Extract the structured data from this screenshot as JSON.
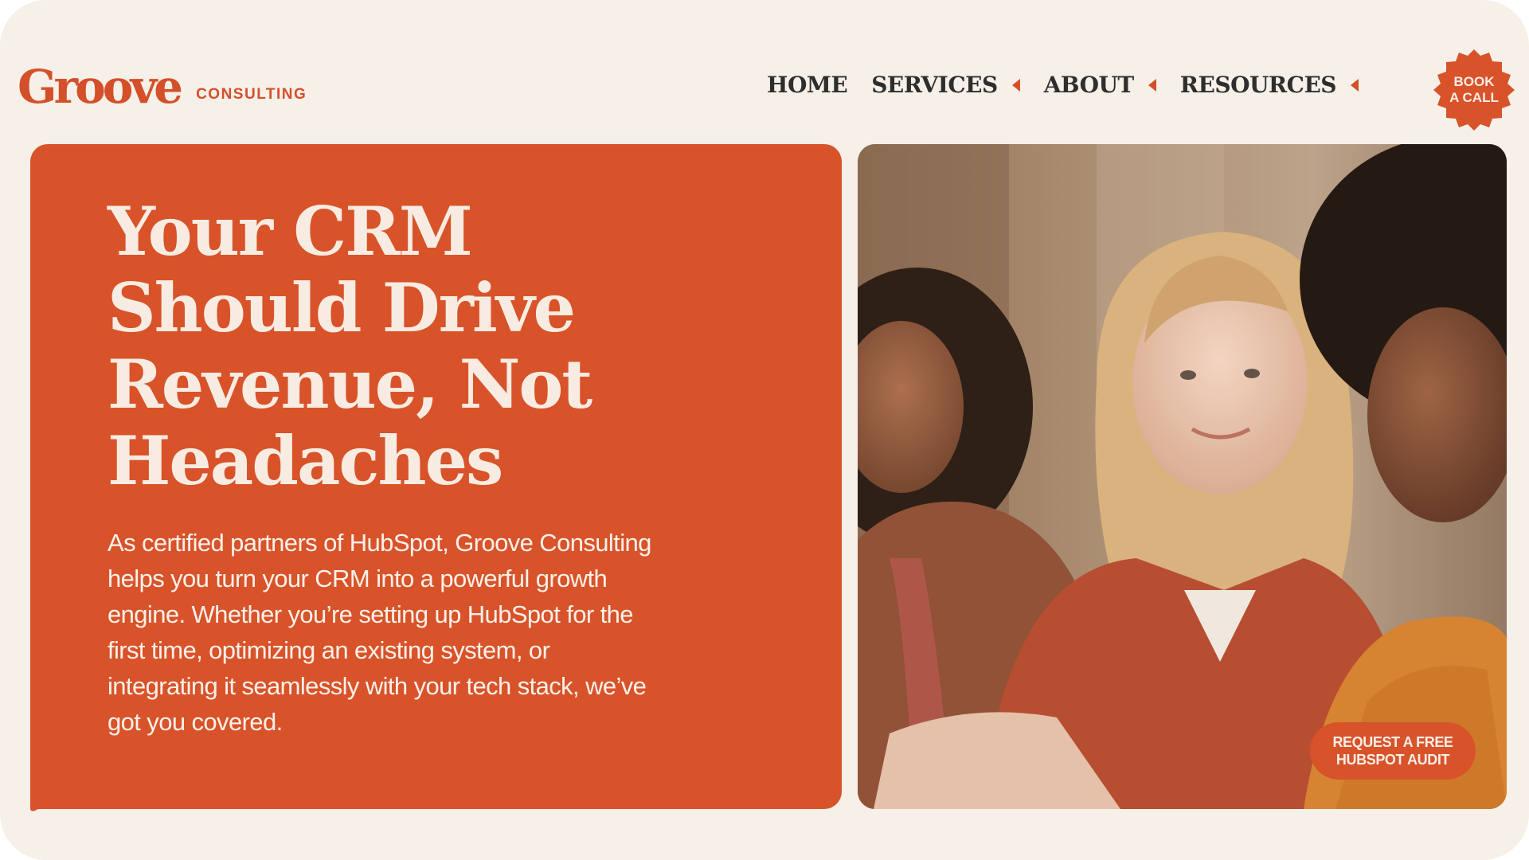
{
  "brand": {
    "logo_word": "Groove",
    "logo_sub": "CONSULTING",
    "accent_color": "#d8532a"
  },
  "nav": {
    "items": [
      {
        "label": "HOME",
        "has_dropdown": false
      },
      {
        "label": "SERVICES",
        "has_dropdown": true
      },
      {
        "label": "ABOUT",
        "has_dropdown": true
      },
      {
        "label": "RESOURCES",
        "has_dropdown": true
      }
    ],
    "cta_label": "BOOK\nA CALL"
  },
  "hero": {
    "title": "Your CRM Should Drive Revenue, Not Headaches",
    "body": "As certified partners of HubSpot, Groove Consulting helps you turn your CRM into a powerful growth engine. Whether you’re setting up HubSpot for the first time, optimizing an existing system, or integrating it seamlessly with your tech stack, we’ve got you covered."
  },
  "photo": {
    "description_icon": "team-photo",
    "audit_button_label": "REQUEST A FREE\nHUBSPOT AUDIT"
  }
}
